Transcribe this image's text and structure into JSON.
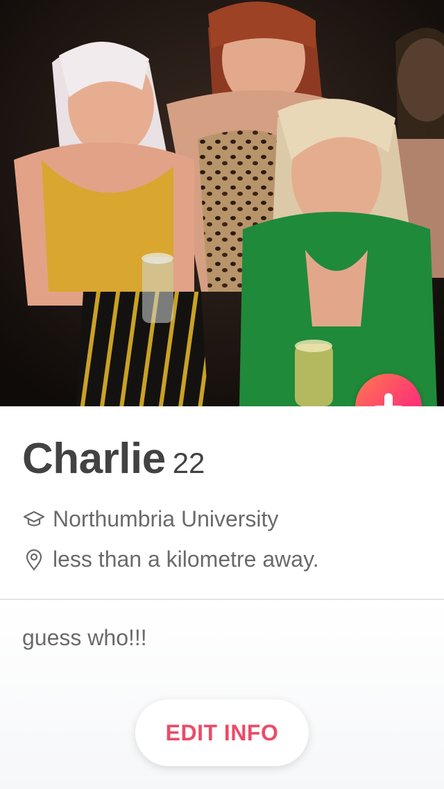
{
  "photo": {
    "alt": "group-photo"
  },
  "profile": {
    "name": "Charlie",
    "age": "22",
    "school": "Northumbria University",
    "distance": "less than a kilometre away.",
    "bio": "guess who!!!"
  },
  "actions": {
    "collapse_icon": "arrow-down-icon",
    "edit_label": "EDIT INFO"
  },
  "colors": {
    "accent": "#fd3a73",
    "accent_gradient_start": "#ff7a4d",
    "edit_text": "#ec4b67",
    "name_text": "#424242",
    "meta_text": "#6a6a6a"
  }
}
